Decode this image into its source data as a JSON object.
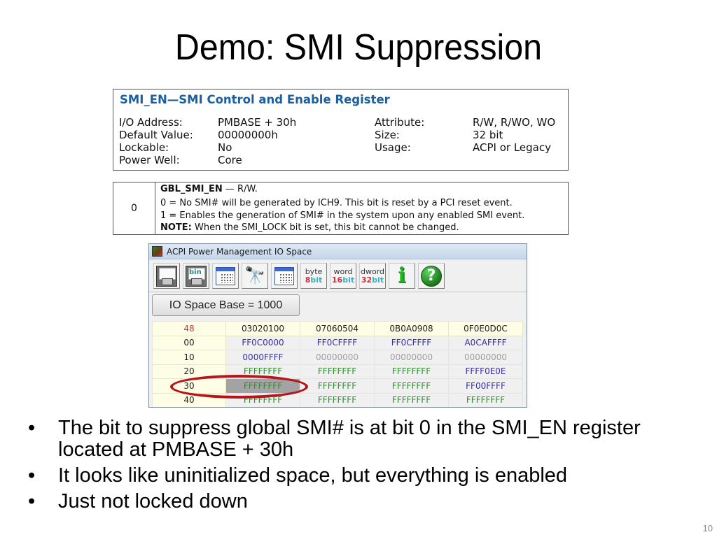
{
  "slide": {
    "title": "Demo: SMI Suppression",
    "page_number": "10",
    "bullets": [
      "The bit to suppress global SMI# is at bit 0 in the SMI_EN register located at PMBASE + 30h",
      "It looks like uninitialized space, but everything is enabled",
      "Just not locked down"
    ]
  },
  "register": {
    "title": "SMI_EN—SMI Control and Enable Register",
    "left_fields": [
      {
        "label": "I/O Address:",
        "value": "PMBASE + 30h"
      },
      {
        "label": "Default Value:",
        "value": "00000000h"
      },
      {
        "label": "Lockable:",
        "value": "No"
      },
      {
        "label": "Power Well:",
        "value": "Core"
      }
    ],
    "right_fields": [
      {
        "label": "Attribute:",
        "value": "R/W, R/WO, WO"
      },
      {
        "label": "Size:",
        "value": "32 bit"
      },
      {
        "label": "Usage:",
        "value": "ACPI or Legacy"
      }
    ]
  },
  "bit_description": {
    "bit": "0",
    "name": "GBL_SMI_EN",
    "access": " — R/W.",
    "line0": "0 = No SMI# will be generated by ICH9. This bit is reset by a PCI reset event.",
    "line1": "1 = Enables the generation of SMI# in the system upon any enabled SMI event.",
    "note_label": "NOTE:",
    "note_text": " When the SMI_LOCK bit is set, this bit cannot be changed."
  },
  "window": {
    "title": "ACPI Power Management IO Space",
    "toolbar": {
      "save": "save-icon",
      "save_bin_label": "bin",
      "byte_top": "byte",
      "byte_num": "8",
      "byte_unit": "bit",
      "word_top": "word",
      "word_num": "16",
      "word_unit": "bit",
      "dword_top": "dword",
      "dword_num": "32",
      "dword_unit": "bit",
      "info_glyph": "i",
      "help_glyph": "?"
    },
    "io_base_button": "IO Space Base = 1000",
    "grid": {
      "corner": "48",
      "columns": [
        "03020100",
        "07060504",
        "0B0A0908",
        "0F0E0D0C"
      ],
      "rows": [
        {
          "offset": "00",
          "cells": [
            {
              "v": "FF0C0000",
              "c": "blue"
            },
            {
              "v": "FF0CFFFF",
              "c": "blue"
            },
            {
              "v": "FF0CFFFF",
              "c": "blue"
            },
            {
              "v": "A0CAFFFF",
              "c": "blue"
            }
          ]
        },
        {
          "offset": "10",
          "cells": [
            {
              "v": "0000FFFF",
              "c": "blue"
            },
            {
              "v": "00000000",
              "c": "gray"
            },
            {
              "v": "00000000",
              "c": "gray"
            },
            {
              "v": "00000000",
              "c": "gray"
            }
          ]
        },
        {
          "offset": "20",
          "cells": [
            {
              "v": "FFFFFFFF",
              "c": "green"
            },
            {
              "v": "FFFFFFFF",
              "c": "green"
            },
            {
              "v": "FFFFFFFF",
              "c": "green"
            },
            {
              "v": "FFFF0E0E",
              "c": "blue"
            }
          ]
        },
        {
          "offset": "30",
          "cells": [
            {
              "v": "FFFFFFFF",
              "c": "green",
              "selected": true
            },
            {
              "v": "FFFFFFFF",
              "c": "green"
            },
            {
              "v": "FFFFFFFF",
              "c": "green"
            },
            {
              "v": "FF00FFFF",
              "c": "blue"
            }
          ]
        },
        {
          "offset": "40",
          "cells": [
            {
              "v": "FFFFFFFF",
              "c": "green"
            },
            {
              "v": "FFFFFFFF",
              "c": "green"
            },
            {
              "v": "FFFFFFFF",
              "c": "green"
            },
            {
              "v": "FFFFFFFF",
              "c": "green"
            }
          ]
        }
      ]
    },
    "highlight_annotation": "red-ellipse around offset 30 row"
  },
  "colors": {
    "register_title": "#1a5fa0",
    "annotation_red": "#b5161b",
    "value_blue": "#3a2fa0",
    "value_green": "#2d8f2d",
    "value_gray": "#a0a0a0",
    "header_red": "#e03030",
    "header_bg": "#fefde6"
  }
}
